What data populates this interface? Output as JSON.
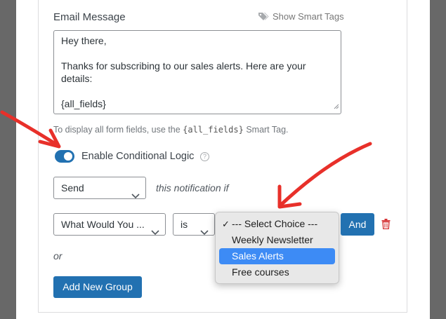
{
  "email_message": {
    "label": "Email Message",
    "smart_tags_link": "Show Smart Tags",
    "body_lines": [
      "Hey there,",
      "",
      "Thanks for subscribing to our sales alerts. Here are your",
      "details:",
      "",
      "{all_fields}"
    ],
    "help_prefix": "To display all form fields, use the",
    "help_code": "{all_fields}",
    "help_suffix": "Smart Tag."
  },
  "conditional_logic": {
    "toggle_label": "Enable Conditional Logic",
    "enabled": true,
    "help_icon": "?",
    "action_select": "Send",
    "notification_text": "this notification if",
    "rule": {
      "field_select": "What Would You ...",
      "operator_select": "is",
      "value_options": [
        "--- Select Choice ---",
        "Weekly Newsletter",
        "Sales Alerts",
        "Free courses"
      ],
      "checked_option": "--- Select Choice ---",
      "highlighted_option": "Sales Alerts",
      "check_mark": "✓"
    },
    "and_button": "And",
    "or_text": "or",
    "add_group_button": "Add New Group"
  },
  "colors": {
    "primary": "#2271b1",
    "delete": "#d63638",
    "annotation_arrow": "#e8302a",
    "highlight": "#3d8bf5"
  },
  "icons": [
    "tag-icon",
    "question-icon",
    "chevron-down-icon",
    "trash-icon",
    "resize-grip-icon",
    "checkmark-icon"
  ]
}
